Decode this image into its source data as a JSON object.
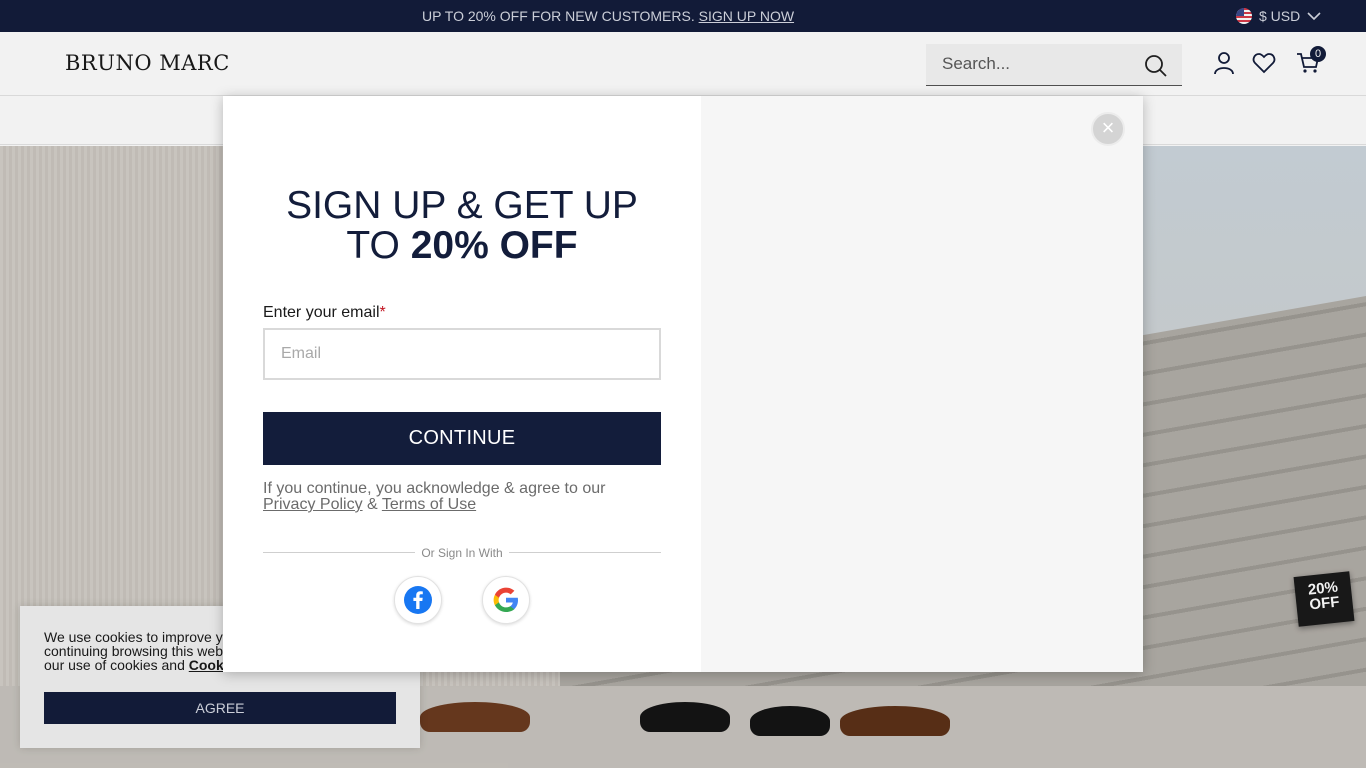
{
  "promo": {
    "text": "UP TO 20% OFF FOR NEW CUSTOMERS.",
    "link": "SIGN UP NOW"
  },
  "currency": {
    "label": "$ USD"
  },
  "header": {
    "logo": "BRUNO MARC",
    "search_placeholder": "Search...",
    "cart_count": "0"
  },
  "badge": {
    "line1": "20%",
    "line2": "OFF"
  },
  "modal": {
    "headline_line1": "SIGN UP & GET UP",
    "headline_line2_prefix": "TO ",
    "headline_line2_bold": "20% OFF",
    "email_label": "Enter your email",
    "email_required_mark": "*",
    "email_placeholder": "Email",
    "continue_label": "CONTINUE",
    "legal_text": "If you continue, you acknowledge & agree to our",
    "privacy_link": "Privacy Policy",
    "amp": " & ",
    "terms_link": "Terms of Use",
    "divider_text": "Or Sign In With",
    "close_label": "×"
  },
  "cookie": {
    "line1": "We use cookies to improve y",
    "line2": "continuing browsing this web",
    "line3_prefix": "our use of cookies and ",
    "line3_link": "Cook",
    "agree_label": "AGREE"
  },
  "colors": {
    "navy": "#131d3b",
    "modal_right": "#f6f6f6"
  }
}
